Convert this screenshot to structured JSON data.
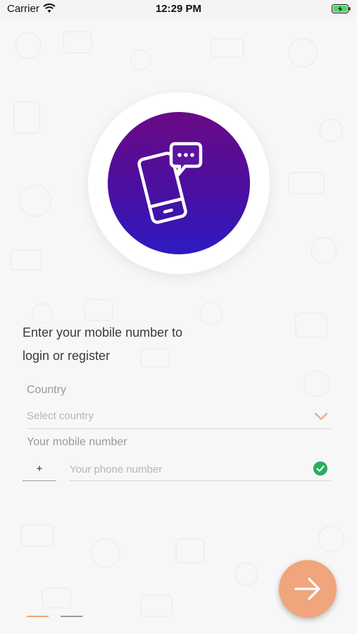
{
  "status_bar": {
    "carrier": "Carrier",
    "time": "12:29 PM"
  },
  "hero": {
    "icon": "phone-chat-icon",
    "gradient_colors": [
      "#6b0a86",
      "#2d1bc2"
    ]
  },
  "prompt": {
    "line1": "Enter your mobile number to",
    "line2": "login or register"
  },
  "country": {
    "label": "Country",
    "placeholder": "Select country"
  },
  "mobile": {
    "label": "Your mobile number",
    "prefix": "+",
    "placeholder": "Your phone number",
    "valid": true
  },
  "actions": {
    "next_icon": "arrow-right-icon",
    "accent_color": "#f0a57c"
  },
  "pager": {
    "total": 2,
    "current": 1
  }
}
